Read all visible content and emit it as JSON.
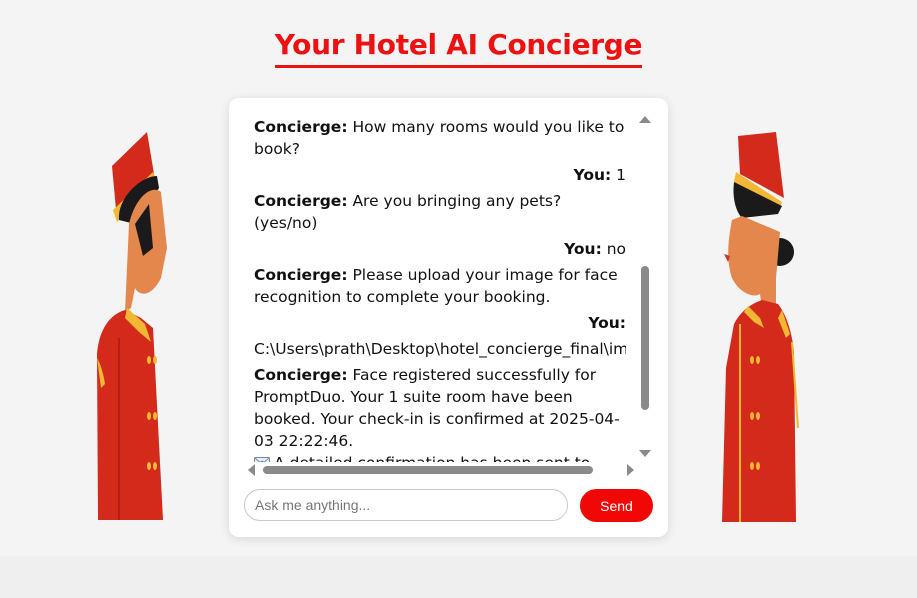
{
  "header": {
    "title": "Your Hotel AI Concierge"
  },
  "chat": {
    "messages": [
      {
        "speaker": "Concierge:",
        "text": " How many rooms would you like to book?",
        "role": "bot"
      },
      {
        "speaker": "You:",
        "text": " 1",
        "role": "user"
      },
      {
        "speaker": "Concierge:",
        "text": " Are you bringing any pets? (yes/no)",
        "role": "bot"
      },
      {
        "speaker": "You:",
        "text": " no",
        "role": "user"
      },
      {
        "speaker": "Concierge:",
        "text": " Please upload your image for face recognition to complete your booking.",
        "role": "bot"
      },
      {
        "speaker": "You:",
        "text": "C:\\Users\\prath\\Desktop\\hotel_concierge_final\\imagee",
        "role": "user"
      },
      {
        "speaker": "Concierge:",
        "text": " Face registered successfully for PromptDuo. Your 1 suite room have been booked. Your check-in is confirmed at 2025-04-03 22:22:46.",
        "text2": "A detailed confirmation has been sent to your email.",
        "icon": "envelope-icon",
        "role": "bot"
      }
    ]
  },
  "input": {
    "placeholder": "Ask me anything...",
    "value": ""
  },
  "send_button": {
    "label": "Send"
  },
  "colors": {
    "accent": "#f20707",
    "title": "#ee1111",
    "uniform": "#d9261c"
  }
}
